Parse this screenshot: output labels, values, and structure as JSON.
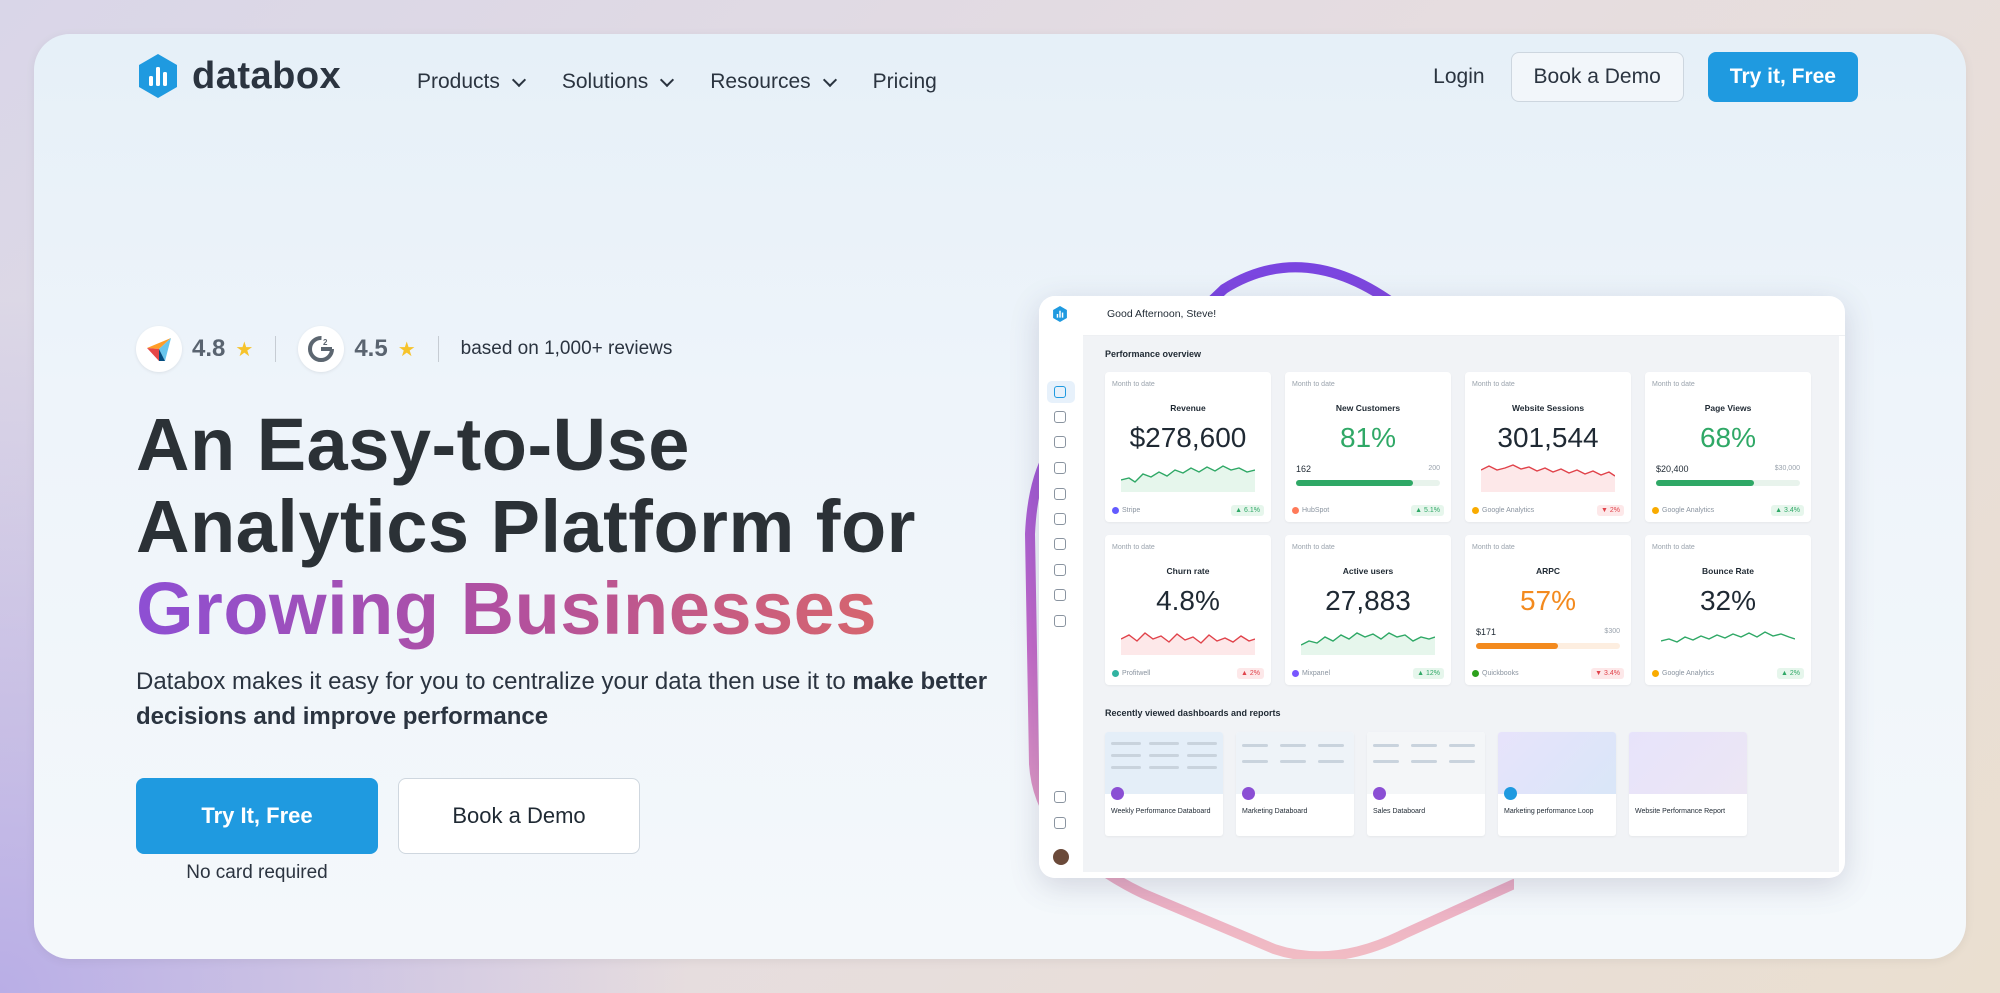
{
  "brand": {
    "name": "databox"
  },
  "nav": {
    "menu": [
      {
        "label": "Products",
        "dropdown": true
      },
      {
        "label": "Solutions",
        "dropdown": true
      },
      {
        "label": "Resources",
        "dropdown": true
      },
      {
        "label": "Pricing",
        "dropdown": false
      }
    ],
    "login": "Login",
    "book_demo": "Book a Demo",
    "try_free": "Try it, Free"
  },
  "ratings": {
    "capterra_score": "4.8",
    "g2_score": "4.5",
    "based_on": "based on 1,000+ reviews"
  },
  "hero": {
    "line1": "An Easy-to-Use",
    "line2": "Analytics Platform for",
    "line3": "Growing Businesses",
    "lede_plain": "Databox makes it easy for you to centralize your data then use it to ",
    "lede_bold": "make better decisions and improve performance",
    "cta_primary": "Try It, Free",
    "cta_secondary": "Book a Demo",
    "no_card": "No card required"
  },
  "app": {
    "greeting": "Good Afternoon, Steve!",
    "section_title": "Performance overview",
    "month_to_date": "Month to date",
    "metrics": [
      {
        "name": "Revenue",
        "value": "$278,600",
        "source": "Stripe",
        "change": "▲ 6.1%",
        "direction": "up",
        "color": "#2fa866"
      },
      {
        "name": "New Customers",
        "value": "81%",
        "source": "HubSpot",
        "change": "▲ 5.1%",
        "direction": "up",
        "progress_value": "162",
        "progress_goal": "200",
        "progress": 0.81
      },
      {
        "name": "Website Sessions",
        "value": "301,544",
        "source": "Google Analytics",
        "change": "▼ 2%",
        "direction": "down",
        "color": "#e0424a"
      },
      {
        "name": "Page Views",
        "value": "68%",
        "source": "Google Analytics",
        "change": "▲ 3.4%",
        "direction": "up",
        "progress_value": "$20,400",
        "progress_goal": "$30,000",
        "progress": 0.68
      },
      {
        "name": "Churn rate",
        "value": "4.8%",
        "source": "Profitwell",
        "change": "▲ 2%",
        "direction": "down",
        "color": "#e0424a"
      },
      {
        "name": "Active users",
        "value": "27,883",
        "source": "Mixpanel",
        "change": "▲ 12%",
        "direction": "up",
        "color": "#2fa866"
      },
      {
        "name": "ARPC",
        "value": "57%",
        "source": "Quickbooks",
        "change": "▼ 3.4%",
        "direction": "down",
        "progress_value": "$171",
        "progress_goal": "$300",
        "progress": 0.57
      },
      {
        "name": "Bounce Rate",
        "value": "32%",
        "source": "Google Analytics",
        "change": "▲ 2%",
        "direction": "up",
        "color": "#2fa866"
      }
    ],
    "recent_title": "Recently viewed dashboards and reports",
    "recent": [
      "Weekly Performance Databoard",
      "Marketing Databoard",
      "Sales Databoard",
      "Marketing performance Loop",
      "Website Performance Report"
    ]
  },
  "colors": {
    "primary": "#1f9ae0",
    "heading": "#2b3136",
    "gradient_start": "#8d4fd4",
    "gradient_end": "#d6656e",
    "positive": "#2fa866",
    "negative": "#e0424a",
    "star": "#f6c32b"
  }
}
